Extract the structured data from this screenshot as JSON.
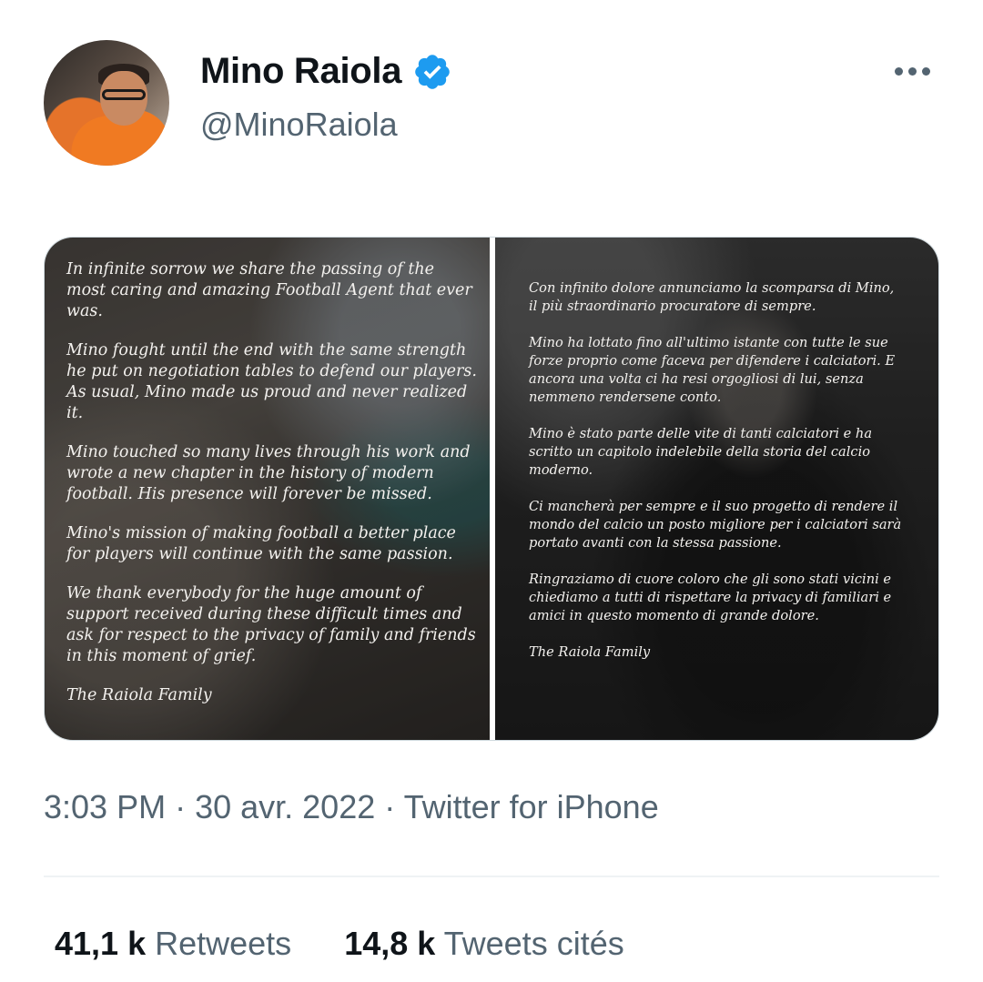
{
  "author": {
    "name": "Mino Raiola",
    "handle": "@MinoRaiola",
    "verified": true,
    "verified_color": "#1d9bf0"
  },
  "media": {
    "left_panel": {
      "paragraphs": [
        "In infinite sorrow we share the passing of the most caring and amazing Football Agent that ever was.",
        "Mino fought until the end with the same strength he put on negotiation tables to defend our players. As usual, Mino made us proud and never realized it.",
        "Mino touched so many lives through his work and wrote a new chapter in the history of modern football. His presence will forever be missed.",
        "Mino's mission of making football a better place for players will continue with the same passion.",
        "We thank everybody for the huge amount of support received during these difficult times and ask for respect to the privacy of family and friends in this moment of grief.",
        "The Raiola Family"
      ]
    },
    "right_panel": {
      "paragraphs": [
        "Con infinito dolore annunciamo la scomparsa di Mino, il più straordinario procuratore di sempre.",
        "Mino ha lottato fino all'ultimo istante con tutte le sue forze proprio come faceva per difendere i calciatori. E ancora una volta ci ha resi orgogliosi di lui, senza nemmeno rendersene conto.",
        "Mino è stato parte delle vite di tanti calciatori e ha scritto un capitolo indelebile della storia del calcio moderno.",
        "Ci mancherà per sempre e il suo progetto di rendere il mondo del calcio un posto migliore per i calciatori sarà portato avanti con la stessa passione.",
        "Ringraziamo di cuore coloro che gli sono stati vicini e chiediamo a tutti di rispettare la privacy di familiari e amici in questo momento di grande dolore.",
        "The Raiola Family"
      ]
    }
  },
  "meta": {
    "time": "3:03 PM",
    "separator": " · ",
    "date": "30 avr. 2022",
    "source": "Twitter for iPhone"
  },
  "stats": {
    "retweets_count": "41,1 k",
    "retweets_label": "Retweets",
    "quotes_count": "14,8 k",
    "quotes_label": "Tweets cités"
  },
  "icons": {
    "more": "more-horizontal-icon",
    "verified": "verified-badge-icon"
  }
}
